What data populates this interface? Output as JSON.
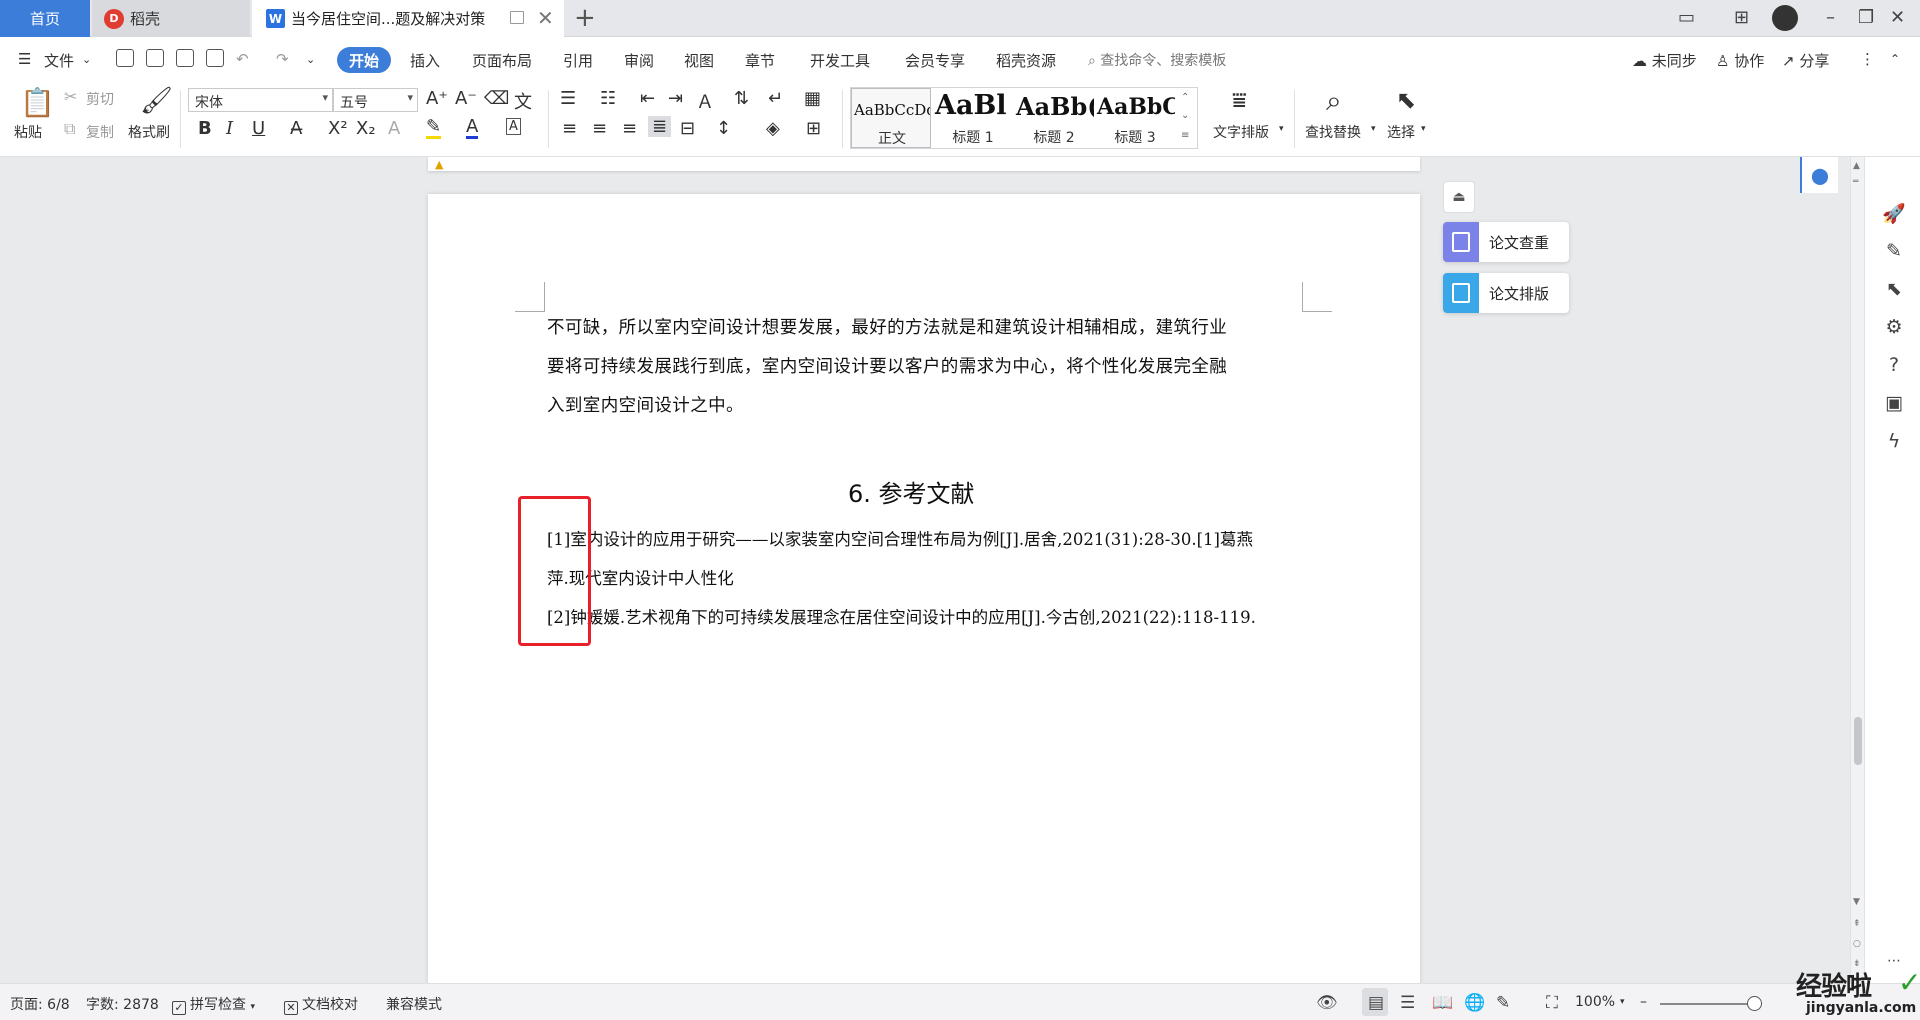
{
  "tabs": {
    "home": "首页",
    "daoke": "稻壳",
    "doc_title": "当今居住空间...题及解决对策"
  },
  "menu": {
    "file": "文件",
    "items": [
      "开始",
      "插入",
      "页面布局",
      "引用",
      "审阅",
      "视图",
      "章节",
      "开发工具",
      "会员专享",
      "稻壳资源"
    ],
    "search_placeholder": "查找命令、搜索模板",
    "unsynced": "未同步",
    "collab": "协作",
    "share": "分享"
  },
  "ribbon": {
    "paste": "粘贴",
    "cut": "剪切",
    "copy": "复制",
    "format_painter": "格式刷",
    "font_name": "宋体",
    "font_size": "五号",
    "styles": [
      {
        "preview": "AaBbCcDd",
        "caption": "正文"
      },
      {
        "preview": "AaBl",
        "caption": "标题 1"
      },
      {
        "preview": "AaBb(",
        "caption": "标题 2"
      },
      {
        "preview": "AaBbC",
        "caption": "标题 3"
      }
    ],
    "text_layout": "文字排版",
    "find_replace": "查找替换",
    "select": "选择"
  },
  "document": {
    "para_lines": [
      "不可缺，所以室内空间设计想要发展，最好的方法就是和建筑设计相辅相成，建筑行业",
      "要将可持续发展践行到底，室内空间设计要以客户的需求为中心，将个性化发展完全融",
      "入到室内空间设计之中。"
    ],
    "heading": "6.  参考文献",
    "refs": [
      "[1]室内设计的应用于研究——以家装室内空间合理性布局为例[J].居舍,2021(31):28-30.[1]葛燕",
      "萍.现代室内设计中人性化",
      "[2]钟媛媛.艺术视角下的可持续发展理念在居住空间设计中的应用[J].今古创,2021(22):118-119."
    ]
  },
  "panel": {
    "check": "论文查重",
    "layout": "论文排版"
  },
  "status": {
    "page": "页面: 6/8",
    "words": "字数: 2878",
    "spell": "拼写检查",
    "proof": "文档校对",
    "compat": "兼容模式",
    "zoom": "100%"
  },
  "watermark": {
    "cn": "经验啦",
    "en": "jingyanla.com"
  },
  "colors": {
    "accent": "#3c7dd9",
    "highlight_box": "#e8202a"
  }
}
